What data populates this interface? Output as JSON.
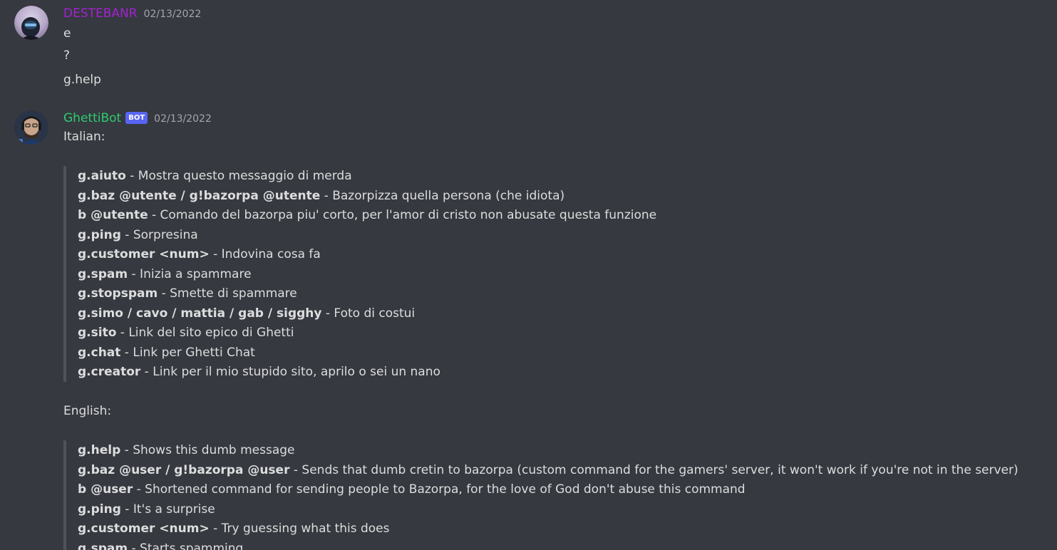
{
  "messages": [
    {
      "author": "DESTEBANR",
      "author_color": "#a521d6",
      "timestamp": "02/13/2022",
      "lines": [
        "e",
        "?",
        "g.help"
      ]
    },
    {
      "author": "GhettiBot",
      "author_color": "#2ecc71",
      "bot_tag": "BOT",
      "timestamp": "02/13/2022",
      "sections": [
        {
          "heading": "Italian:",
          "commands": [
            {
              "cmd": "g.aiuto",
              "desc": " - Mostra questo messaggio di merda"
            },
            {
              "cmd": "g.baz @utente / g!bazorpa @utente",
              "desc": " - Bazorpizza quella persona (che idiota)"
            },
            {
              "cmd": "b @utente",
              "desc": " - Comando del bazorpa piu' corto, per l'amor di cristo non abusate questa funzione"
            },
            {
              "cmd": "g.ping",
              "desc": " - Sorpresina"
            },
            {
              "cmd": "g.customer <num>",
              "desc": " - Indovina cosa fa"
            },
            {
              "cmd": "g.spam",
              "desc": " - Inizia a spammare"
            },
            {
              "cmd": "g.stopspam",
              "desc": " - Smette di spammare"
            },
            {
              "cmd": "g.simo / cavo / mattia / gab / sigghy",
              "desc": " - Foto di costui"
            },
            {
              "cmd": "g.sito",
              "desc": " - Link del sito epico di Ghetti"
            },
            {
              "cmd": "g.chat",
              "desc": " - Link per Ghetti Chat"
            },
            {
              "cmd": "g.creator",
              "desc": " - Link per il mio stupido sito, aprilo o sei un nano"
            }
          ]
        },
        {
          "heading": "English:",
          "commands": [
            {
              "cmd": "g.help",
              "desc": " - Shows this dumb message"
            },
            {
              "cmd": "g.baz @user / g!bazorpa @user",
              "desc": " - Sends that dumb cretin to bazorpa (custom command for the gamers' server, it won't work if you're not in the server)"
            },
            {
              "cmd": "b @user",
              "desc": " - Shortened command for sending people to Bazorpa, for the love of God don't abuse this command"
            },
            {
              "cmd": "g.ping",
              "desc": " - It's a surprise"
            },
            {
              "cmd": "g.customer <num>",
              "desc": " - Try guessing what this does"
            },
            {
              "cmd": "g.spam",
              "desc": " - Starts spamming"
            }
          ]
        }
      ]
    }
  ]
}
